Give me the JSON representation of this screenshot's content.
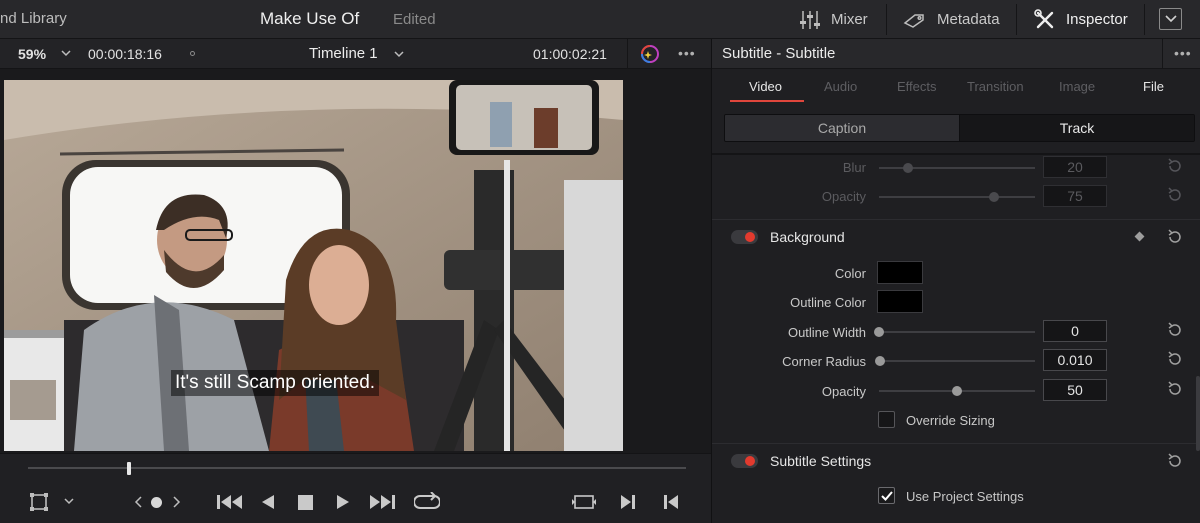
{
  "topbar": {
    "library_label": "nd Library",
    "project_name": "Make Use Of",
    "project_status": "Edited",
    "mixer_label": "Mixer",
    "metadata_label": "Metadata",
    "inspector_label": "Inspector"
  },
  "viewer": {
    "zoom": "59%",
    "source_timecode": "00:00:18:16",
    "timeline_name": "Timeline 1",
    "record_timecode": "01:00:02:21",
    "subtitle_text": "It's still Scamp oriented.",
    "playhead_fraction": 0.152
  },
  "inspector": {
    "title": "Subtitle - Subtitle",
    "tabs": [
      "Video",
      "Audio",
      "Effects",
      "Transition",
      "Image",
      "File"
    ],
    "active_tab": "Video",
    "segments": [
      "Caption",
      "Track"
    ],
    "active_segment": "Track",
    "blur": {
      "label": "Blur",
      "value": "20"
    },
    "top_opacity": {
      "label": "Opacity",
      "value": "75"
    },
    "background": {
      "title": "Background",
      "enabled": true,
      "color_label": "Color",
      "color_value": "#000000",
      "outline_color_label": "Outline Color",
      "outline_color_value": "#000000",
      "outline_width": {
        "label": "Outline Width",
        "value": "0"
      },
      "corner_radius": {
        "label": "Corner Radius",
        "value": "0.010"
      },
      "opacity": {
        "label": "Opacity",
        "value": "50"
      },
      "override_sizing_label": "Override Sizing",
      "override_sizing_checked": false
    },
    "subtitle_settings": {
      "title": "Subtitle Settings",
      "enabled": true,
      "use_project_settings_label": "Use Project Settings",
      "use_project_settings_checked": true
    }
  },
  "colors": {
    "accent_red": "#e0463c",
    "panel": "#1f1f22"
  }
}
